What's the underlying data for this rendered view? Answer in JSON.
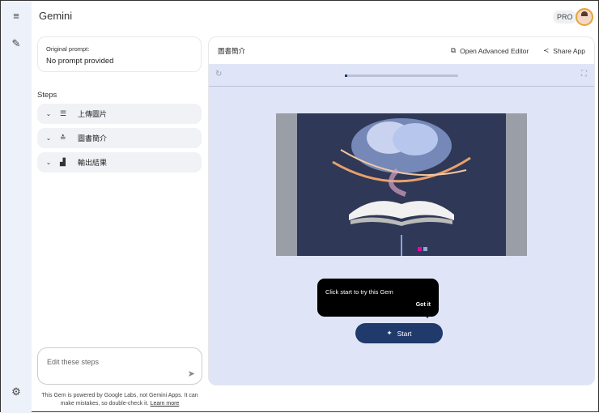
{
  "app": {
    "title": "Gemini",
    "pro_badge": "PRO"
  },
  "left": {
    "original_prompt_label": "Original prompt:",
    "original_prompt_value": "No prompt provided",
    "steps_heading": "Steps",
    "steps": [
      {
        "label": "上傳圖片",
        "icon": "table-rows-icon"
      },
      {
        "label": "圖書簡介",
        "icon": "playlist-add-icon"
      },
      {
        "label": "輸出結果",
        "icon": "bar-chart-icon"
      }
    ],
    "edit_placeholder": "Edit these steps",
    "disclaimer": "This Gem is powered by Google Labs, not Gemini Apps. It can make mistakes, so double-check it.",
    "learn_more": "Learn more"
  },
  "panel": {
    "title": "圖書簡介",
    "open_editor": "Open Advanced Editor",
    "share": "Share App",
    "progress_percent": 2,
    "tooltip_text": "Click start to try this Gem",
    "tooltip_button": "Got it",
    "start_label": "Start"
  }
}
